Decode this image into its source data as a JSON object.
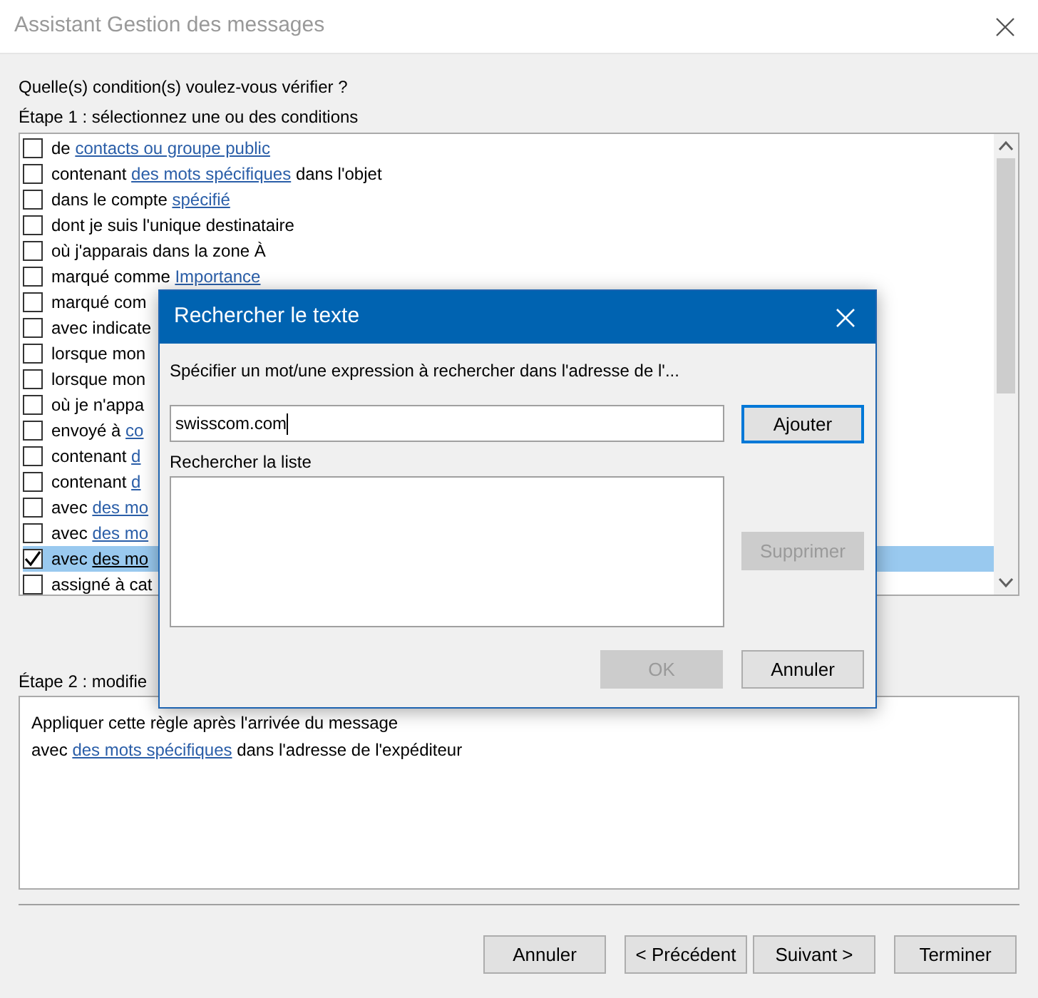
{
  "window": {
    "title": "Assistant Gestion des messages"
  },
  "question": "Quelle(s) condition(s) voulez-vous vérifier ?",
  "step1_label": "Étape 1 : sélectionnez une ou des conditions",
  "conditions": [
    {
      "checked": false,
      "selected": false,
      "parts": [
        {
          "text": "de ",
          "link": false
        },
        {
          "text": "contacts ou groupe public",
          "link": true
        }
      ]
    },
    {
      "checked": false,
      "selected": false,
      "parts": [
        {
          "text": "contenant ",
          "link": false
        },
        {
          "text": "des mots spécifiques",
          "link": true
        },
        {
          "text": " dans l'objet",
          "link": false
        }
      ]
    },
    {
      "checked": false,
      "selected": false,
      "parts": [
        {
          "text": "dans le compte ",
          "link": false
        },
        {
          "text": "spécifié",
          "link": true
        }
      ]
    },
    {
      "checked": false,
      "selected": false,
      "parts": [
        {
          "text": "dont je suis l'unique destinataire",
          "link": false
        }
      ]
    },
    {
      "checked": false,
      "selected": false,
      "parts": [
        {
          "text": "où j'apparais dans la zone À",
          "link": false
        }
      ]
    },
    {
      "checked": false,
      "selected": false,
      "parts": [
        {
          "text": "marqué comme ",
          "link": false
        },
        {
          "text": "Importance",
          "link": true
        }
      ]
    },
    {
      "checked": false,
      "selected": false,
      "parts": [
        {
          "text": "marqué com",
          "link": false
        }
      ]
    },
    {
      "checked": false,
      "selected": false,
      "parts": [
        {
          "text": "avec indicate",
          "link": false
        }
      ]
    },
    {
      "checked": false,
      "selected": false,
      "parts": [
        {
          "text": "lorsque mon",
          "link": false
        }
      ]
    },
    {
      "checked": false,
      "selected": false,
      "parts": [
        {
          "text": "lorsque mon",
          "link": false
        }
      ]
    },
    {
      "checked": false,
      "selected": false,
      "parts": [
        {
          "text": "où je n'appa",
          "link": false
        }
      ]
    },
    {
      "checked": false,
      "selected": false,
      "parts": [
        {
          "text": "envoyé à ",
          "link": false
        },
        {
          "text": "co",
          "link": true
        }
      ]
    },
    {
      "checked": false,
      "selected": false,
      "parts": [
        {
          "text": "contenant ",
          "link": false
        },
        {
          "text": "d",
          "link": true
        }
      ]
    },
    {
      "checked": false,
      "selected": false,
      "parts": [
        {
          "text": "contenant ",
          "link": false
        },
        {
          "text": "d",
          "link": true
        }
      ]
    },
    {
      "checked": false,
      "selected": false,
      "parts": [
        {
          "text": "avec ",
          "link": false
        },
        {
          "text": "des mo",
          "link": true
        }
      ]
    },
    {
      "checked": false,
      "selected": false,
      "parts": [
        {
          "text": "avec ",
          "link": false
        },
        {
          "text": "des mo",
          "link": true
        }
      ]
    },
    {
      "checked": true,
      "selected": true,
      "parts": [
        {
          "text": "avec ",
          "link": false
        },
        {
          "text": "des mo",
          "link": true
        }
      ]
    },
    {
      "checked": false,
      "selected": false,
      "parts": [
        {
          "text": "assigné à cat",
          "link": false
        }
      ]
    }
  ],
  "step2_label": "Étape 2 : modifie",
  "description": [
    [
      {
        "text": "Appliquer cette règle après l'arrivée du message",
        "link": false
      }
    ],
    [
      {
        "text": "avec ",
        "link": false
      },
      {
        "text": "des mots spécifiques",
        "link": true
      },
      {
        "text": " dans l'adresse de l'expéditeur",
        "link": false
      }
    ]
  ],
  "buttons": [
    {
      "label": "Annuler"
    },
    {
      "label": "< Précédent"
    },
    {
      "label": "Suivant >"
    },
    {
      "label": "Terminer"
    }
  ],
  "dialog": {
    "title": "Rechercher le texte",
    "prompt": "Spécifier un mot/une expression à rechercher dans l'adresse de l'...",
    "value": "swisscom.com",
    "list_label": "Rechercher la liste",
    "add_button": {
      "label": "Ajouter",
      "disabled": false
    },
    "remove_button": {
      "label": "Supprimer",
      "disabled": true
    },
    "ok_button": {
      "label": "OK",
      "disabled": true
    },
    "cancel_button": {
      "label": "Annuler",
      "disabled": false
    }
  }
}
